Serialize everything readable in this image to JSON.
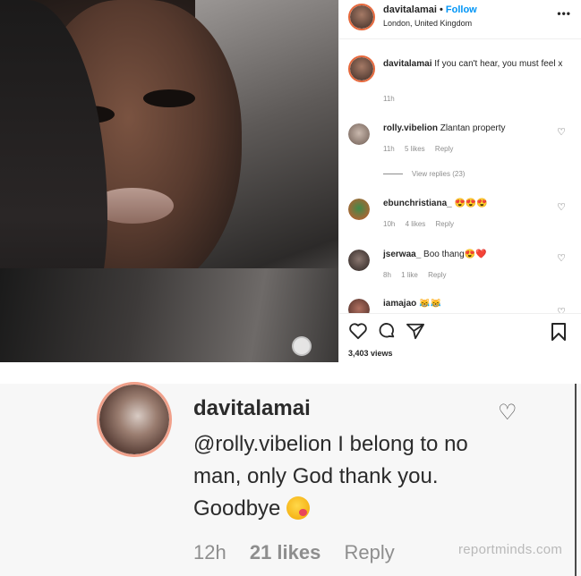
{
  "post": {
    "owner": {
      "username": "davitalamai",
      "follow_label": "Follow",
      "separator": "•",
      "location": "London, United Kingdom"
    },
    "more_label": "•••",
    "caption": {
      "username": "davitalamai",
      "text": "If you can't hear, you must feel x",
      "time": "11h"
    },
    "comments": [
      {
        "username": "rolly.vibelion",
        "text": "Zlantan property",
        "time": "11h",
        "likes": "5 likes",
        "reply": "Reply"
      },
      {
        "username": "ebunchristiana_",
        "text": "😍😍😍",
        "time": "10h",
        "likes": "4 likes",
        "reply": "Reply"
      },
      {
        "username": "jserwaa_",
        "text": "Boo thang😍❤️",
        "time": "8h",
        "likes": "1 like",
        "reply": "Reply"
      },
      {
        "username": "iamajao",
        "text": "😹😹",
        "time": "",
        "likes": "",
        "reply": ""
      }
    ],
    "view_replies": "View replies (23)",
    "views": "3,403 views",
    "icons": {
      "like": "heart-icon",
      "comment": "comment-icon",
      "share": "send-icon",
      "save": "bookmark-icon"
    }
  },
  "zoomed_comment": {
    "username": "davitalamai",
    "text": "@rolly.vibelion I belong to no man, only God thank you. Goodbye",
    "emoji": "😘",
    "time": "12h",
    "likes": "21 likes",
    "reply": "Reply"
  },
  "watermark": "reportminds.com",
  "colors": {
    "follow": "#0095f6",
    "muted": "#8e8e8e",
    "text": "#262626"
  }
}
